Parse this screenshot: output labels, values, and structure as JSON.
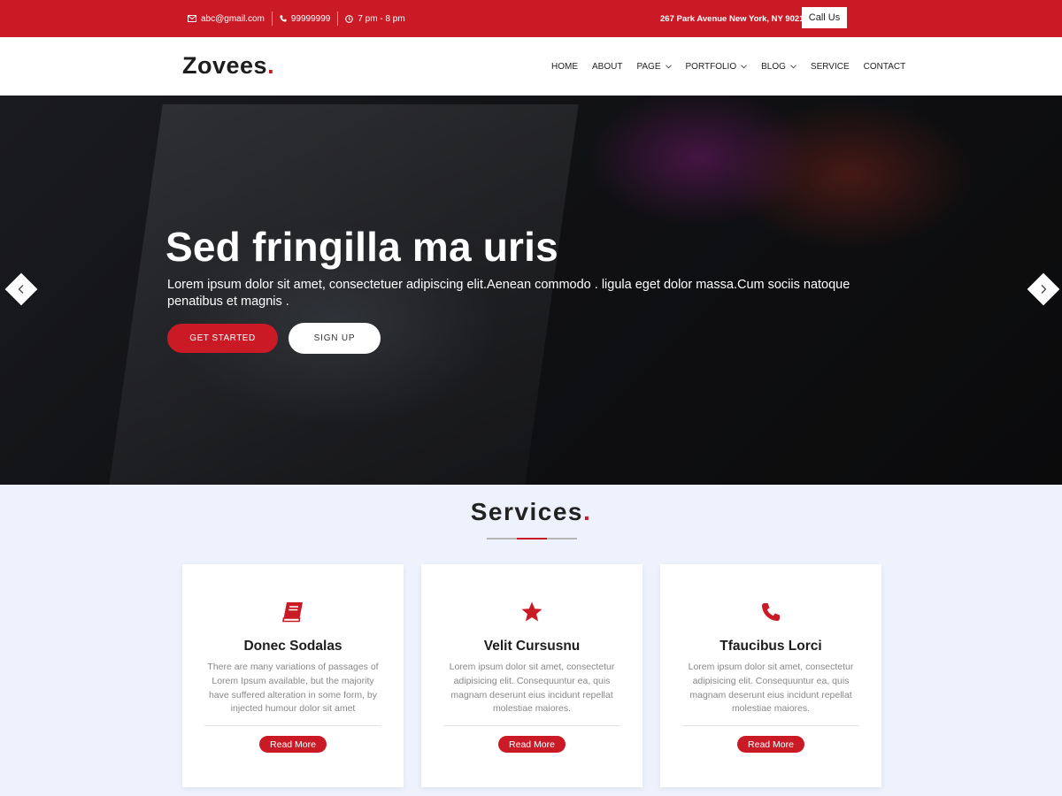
{
  "topbar": {
    "email": "abc@gmail.com",
    "phone": "99999999",
    "hours": "7 pm - 8 pm",
    "address": "267 Park Avenue New York, NY 90210",
    "call_button": "Call Us",
    "email_icon": "envelope-icon",
    "phone_icon": "phone-icon",
    "hours_icon": "clock-icon"
  },
  "header": {
    "logo_text": "Zovees",
    "logo_dot": ".",
    "nav": [
      {
        "label": "HOME",
        "dropdown": false
      },
      {
        "label": "ABOUT",
        "dropdown": false
      },
      {
        "label": "PAGE",
        "dropdown": true
      },
      {
        "label": "PORTFOLIO",
        "dropdown": true
      },
      {
        "label": "BLOG",
        "dropdown": true
      },
      {
        "label": "SERVICE",
        "dropdown": false
      },
      {
        "label": "CONTACT",
        "dropdown": false
      }
    ]
  },
  "hero": {
    "title": "Sed fringilla ma uris",
    "text": "Lorem ipsum dolor sit amet, consectetuer adipiscing elit.Aenean commodo . ligula eget dolor massa.Cum sociis natoque penatibus et magnis .",
    "primary_button": "GET STARTED",
    "secondary_button": "SIGN UP",
    "prev_icon": "chevron-left-icon",
    "next_icon": "chevron-right-icon"
  },
  "services": {
    "title": "Services",
    "title_dot": ".",
    "cards": [
      {
        "icon": "book-icon",
        "title": "Donec Sodalas",
        "text": "There are many variations of passages of Lorem Ipsum available, but the majority have suffered alteration in some form, by injected humour dolor sit amet",
        "button": "Read More"
      },
      {
        "icon": "star-icon",
        "title": "Velit Cursusnu",
        "text": "Lorem ipsum dolor sit amet, consectetur adipisicing elit. Consequuntur ea, quis magnam deserunt eius incidunt repellat molestiae maiores.",
        "button": "Read More"
      },
      {
        "icon": "phone-icon",
        "title": "Tfaucibus Lorci",
        "text": "Lorem ipsum dolor sit amet, consectetur adipisicing elit. Consequuntur ea, quis magnam deserunt eius incidunt repellat molestiae maiores.",
        "button": "Read More"
      }
    ]
  },
  "colors": {
    "accent": "#c91a26",
    "page_background": "#edf2fc"
  }
}
